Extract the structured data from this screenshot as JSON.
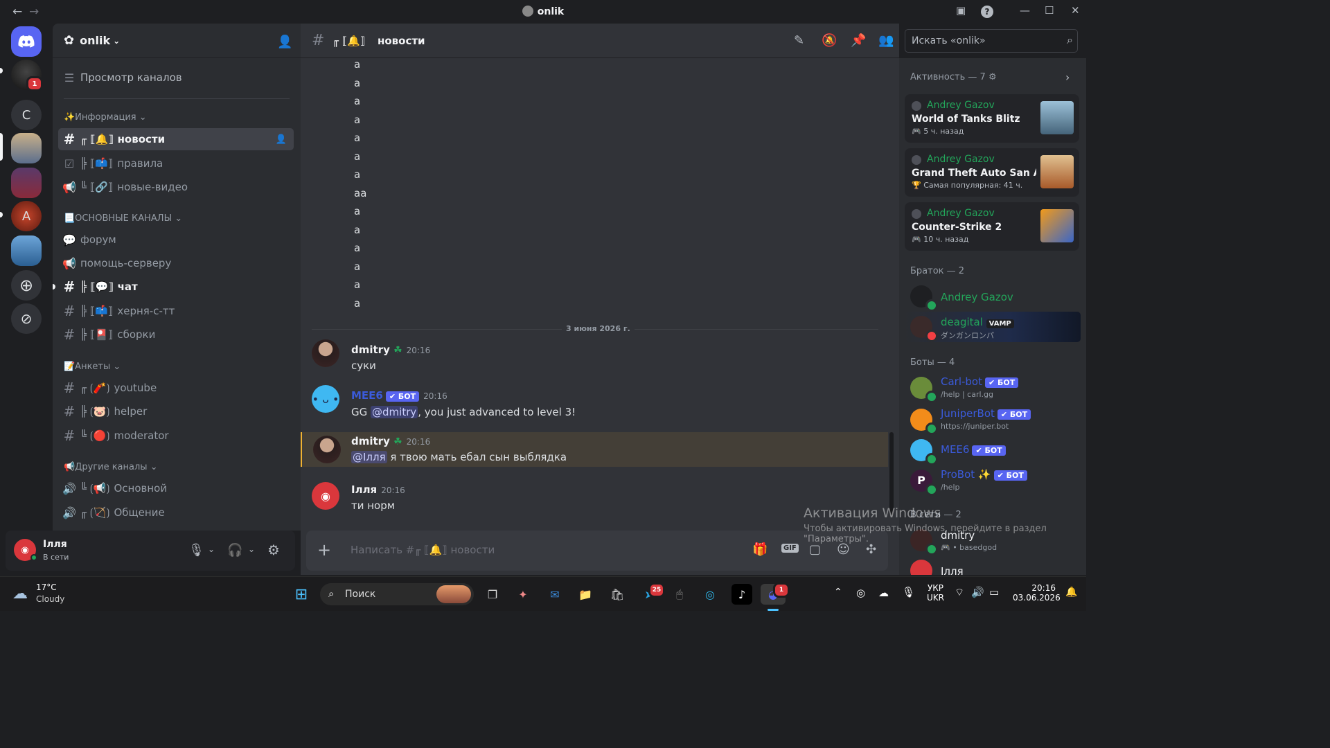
{
  "window": {
    "title": "onlik"
  },
  "rail": {
    "letter_server": "С",
    "home_badge": "1"
  },
  "server": {
    "name": "onlik",
    "browse_label": "Просмотр каналов",
    "categories": [
      {
        "label": "✨Информация",
        "channels": [
          {
            "prefix": "╓ ⟦🔔⟧",
            "name": "новости",
            "icon": "#"
          },
          {
            "prefix": "╠ ⟦📫⟧",
            "name": "правила",
            "icon": "☑"
          },
          {
            "prefix": "╚ ⟦🔗⟧",
            "name": "новые-видео",
            "icon": "📢"
          }
        ]
      },
      {
        "label": "📃ОСНОВНЫЕ КАНАЛЫ",
        "channels": [
          {
            "prefix": "",
            "name": "форум",
            "icon": "💬"
          },
          {
            "prefix": "",
            "name": "помощь-серверу",
            "icon": "📢"
          },
          {
            "prefix": "╠ ⟦💬⟧",
            "name": "чат",
            "icon": "#"
          },
          {
            "prefix": "╠ ⟦📫⟧",
            "name": "херня-с-тт",
            "icon": "#"
          },
          {
            "prefix": "╠ ⟦🎴⟧",
            "name": "сборки",
            "icon": "#"
          }
        ]
      },
      {
        "label": "📝Анкеты",
        "channels": [
          {
            "prefix": "╓ ⟮🧨⟯",
            "name": "youtube",
            "icon": "#"
          },
          {
            "prefix": "╠ ⟮🐷⟯",
            "name": "helper",
            "icon": "#"
          },
          {
            "prefix": "╚ ⟮🔴⟯",
            "name": "moderator",
            "icon": "#"
          }
        ]
      },
      {
        "label": "📢Другие каналы",
        "channels": [
          {
            "prefix": "╚ ⟮📢⟯",
            "name": "Основной",
            "icon": "🔊"
          },
          {
            "prefix": "╓ ⟮🏹⟯",
            "name": "Общение",
            "icon": "🔊"
          }
        ]
      }
    ]
  },
  "user": {
    "name": "Ілля",
    "status": "В сети"
  },
  "channel": {
    "prefix": "╓ ⟦🔔⟧",
    "name": "новости"
  },
  "search": {
    "placeholder": "Искать «onlik»"
  },
  "chat": {
    "short_lines": [
      "а",
      "а",
      "а",
      "а",
      "а",
      "а",
      "а",
      "аа",
      "а",
      "а",
      "а",
      "а",
      "а",
      "а"
    ],
    "date_divider": "3 июня 2026 г.",
    "messages": [
      {
        "author": "dmitry",
        "time": "20:16",
        "text": "суки"
      },
      {
        "author": "MEE6",
        "bot": "БОТ",
        "time": "20:16",
        "pre": "GG ",
        "mention": "@dmitry",
        "post": ", you just advanced to level 3!"
      },
      {
        "author": "dmitry",
        "time": "20:16",
        "mention": "@Ілля",
        "post": " я твою мать ебал сын выблядка"
      },
      {
        "author": "Ілля",
        "time": "20:16",
        "text": "ти норм"
      }
    ],
    "input_placeholder": "Написать #╓ ⟦🔔⟧ новости"
  },
  "members": {
    "activity_header": "Активность — 7",
    "activities": [
      {
        "user": "Andrey Gazov",
        "game": "World of Tanks Blitz",
        "detail": "5 ч. назад"
      },
      {
        "user": "Andrey Gazov",
        "game": "Grand Theft Auto San Andr...",
        "detail": "Самая популярная: 41 ч."
      },
      {
        "user": "Andrey Gazov",
        "game": "Counter-Strike 2",
        "detail": "10 ч. назад"
      }
    ],
    "group1_header": "Браток — 2",
    "group1": [
      {
        "name": "Andrey Gazov",
        "sub": ""
      },
      {
        "name": "deagital",
        "tag": "VAMP",
        "sub": "ダンガンロンパ"
      }
    ],
    "bots_header": "Боты — 4",
    "bots": [
      {
        "name": "Carl-bot",
        "badge": "БОТ",
        "sub": "/help | carl.gg"
      },
      {
        "name": "JuniperBot",
        "badge": "БОТ",
        "sub": "https://juniper.bot"
      },
      {
        "name": "MEE6",
        "badge": "БОТ",
        "sub": ""
      },
      {
        "name": "ProBot ✨",
        "badge": "БОТ",
        "sub": "/help"
      }
    ],
    "online_header": "В сети — 2",
    "online": [
      {
        "name": "dmitry",
        "sub": "🎮 • basedgod"
      },
      {
        "name": "Ілля",
        "sub": ""
      }
    ]
  },
  "watermark": {
    "title": "Активация Windows",
    "line1": "Чтобы активировать Windows, перейдите в раздел",
    "line2": "\"Параметры\"."
  },
  "taskbar": {
    "temp": "17°C",
    "weather": "Cloudy",
    "search_label": "Поиск",
    "telegram_badge": "25",
    "discord_badge": "1",
    "lang1": "УКР",
    "lang2": "UKR",
    "time": "20:16",
    "date": "03.06.2026"
  }
}
